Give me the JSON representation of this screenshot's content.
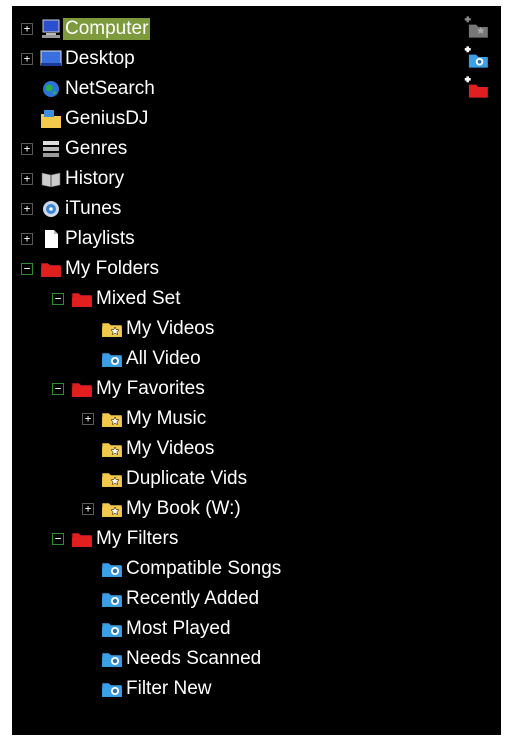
{
  "tree": [
    {
      "label": "Computer",
      "icon": "computer-icon",
      "level": 0,
      "toggle": "+",
      "selected": true
    },
    {
      "label": "Desktop",
      "icon": "desktop-icon",
      "level": 0,
      "toggle": "+"
    },
    {
      "label": "NetSearch",
      "icon": "globe-icon",
      "level": 0,
      "toggle": null
    },
    {
      "label": "GeniusDJ",
      "icon": "genius-folder-icon",
      "level": 0,
      "toggle": null
    },
    {
      "label": "Genres",
      "icon": "genres-icon",
      "level": 0,
      "toggle": "+"
    },
    {
      "label": "History",
      "icon": "history-icon",
      "level": 0,
      "toggle": "+"
    },
    {
      "label": "iTunes",
      "icon": "itunes-icon",
      "level": 0,
      "toggle": "+"
    },
    {
      "label": "Playlists",
      "icon": "playlist-icon",
      "level": 0,
      "toggle": "+"
    },
    {
      "label": "My Folders",
      "icon": "red-folder-icon",
      "level": 0,
      "toggle": "−"
    },
    {
      "label": "Mixed Set",
      "icon": "red-folder-icon",
      "level": 1,
      "toggle": "−"
    },
    {
      "label": "My Videos",
      "icon": "star-folder-icon",
      "level": 2,
      "toggle": null
    },
    {
      "label": "All Video",
      "icon": "filter-folder-icon",
      "level": 2,
      "toggle": null
    },
    {
      "label": "My Favorites",
      "icon": "red-folder-icon",
      "level": 1,
      "toggle": "−"
    },
    {
      "label": "My Music",
      "icon": "star-folder-icon",
      "level": 2,
      "toggle": "+"
    },
    {
      "label": "My Videos",
      "icon": "star-folder-icon",
      "level": 2,
      "toggle": null
    },
    {
      "label": "Duplicate Vids",
      "icon": "star-folder-icon",
      "level": 2,
      "toggle": null
    },
    {
      "label": "My Book (W:)",
      "icon": "star-folder-icon",
      "level": 2,
      "toggle": "+"
    },
    {
      "label": "My Filters",
      "icon": "red-folder-icon",
      "level": 1,
      "toggle": "−"
    },
    {
      "label": "Compatible Songs",
      "icon": "filter-folder-icon",
      "level": 2,
      "toggle": null
    },
    {
      "label": "Recently Added",
      "icon": "filter-folder-icon",
      "level": 2,
      "toggle": null
    },
    {
      "label": "Most Played",
      "icon": "filter-folder-icon",
      "level": 2,
      "toggle": null
    },
    {
      "label": "Needs Scanned",
      "icon": "filter-folder-icon",
      "level": 2,
      "toggle": null
    },
    {
      "label": "Filter New",
      "icon": "filter-folder-icon",
      "level": 2,
      "toggle": null
    }
  ],
  "side_buttons": [
    {
      "icon": "add-star-folder-icon",
      "enabled": false
    },
    {
      "icon": "add-filter-folder-icon",
      "enabled": true
    },
    {
      "icon": "add-red-folder-icon",
      "enabled": true
    }
  ],
  "colors": {
    "background": "#000000",
    "text": "#ffffff",
    "selection": "#7d9a3c",
    "folder_yellow": "#f2c94c",
    "folder_red": "#e02020",
    "folder_blue": "#3aa0e8"
  }
}
